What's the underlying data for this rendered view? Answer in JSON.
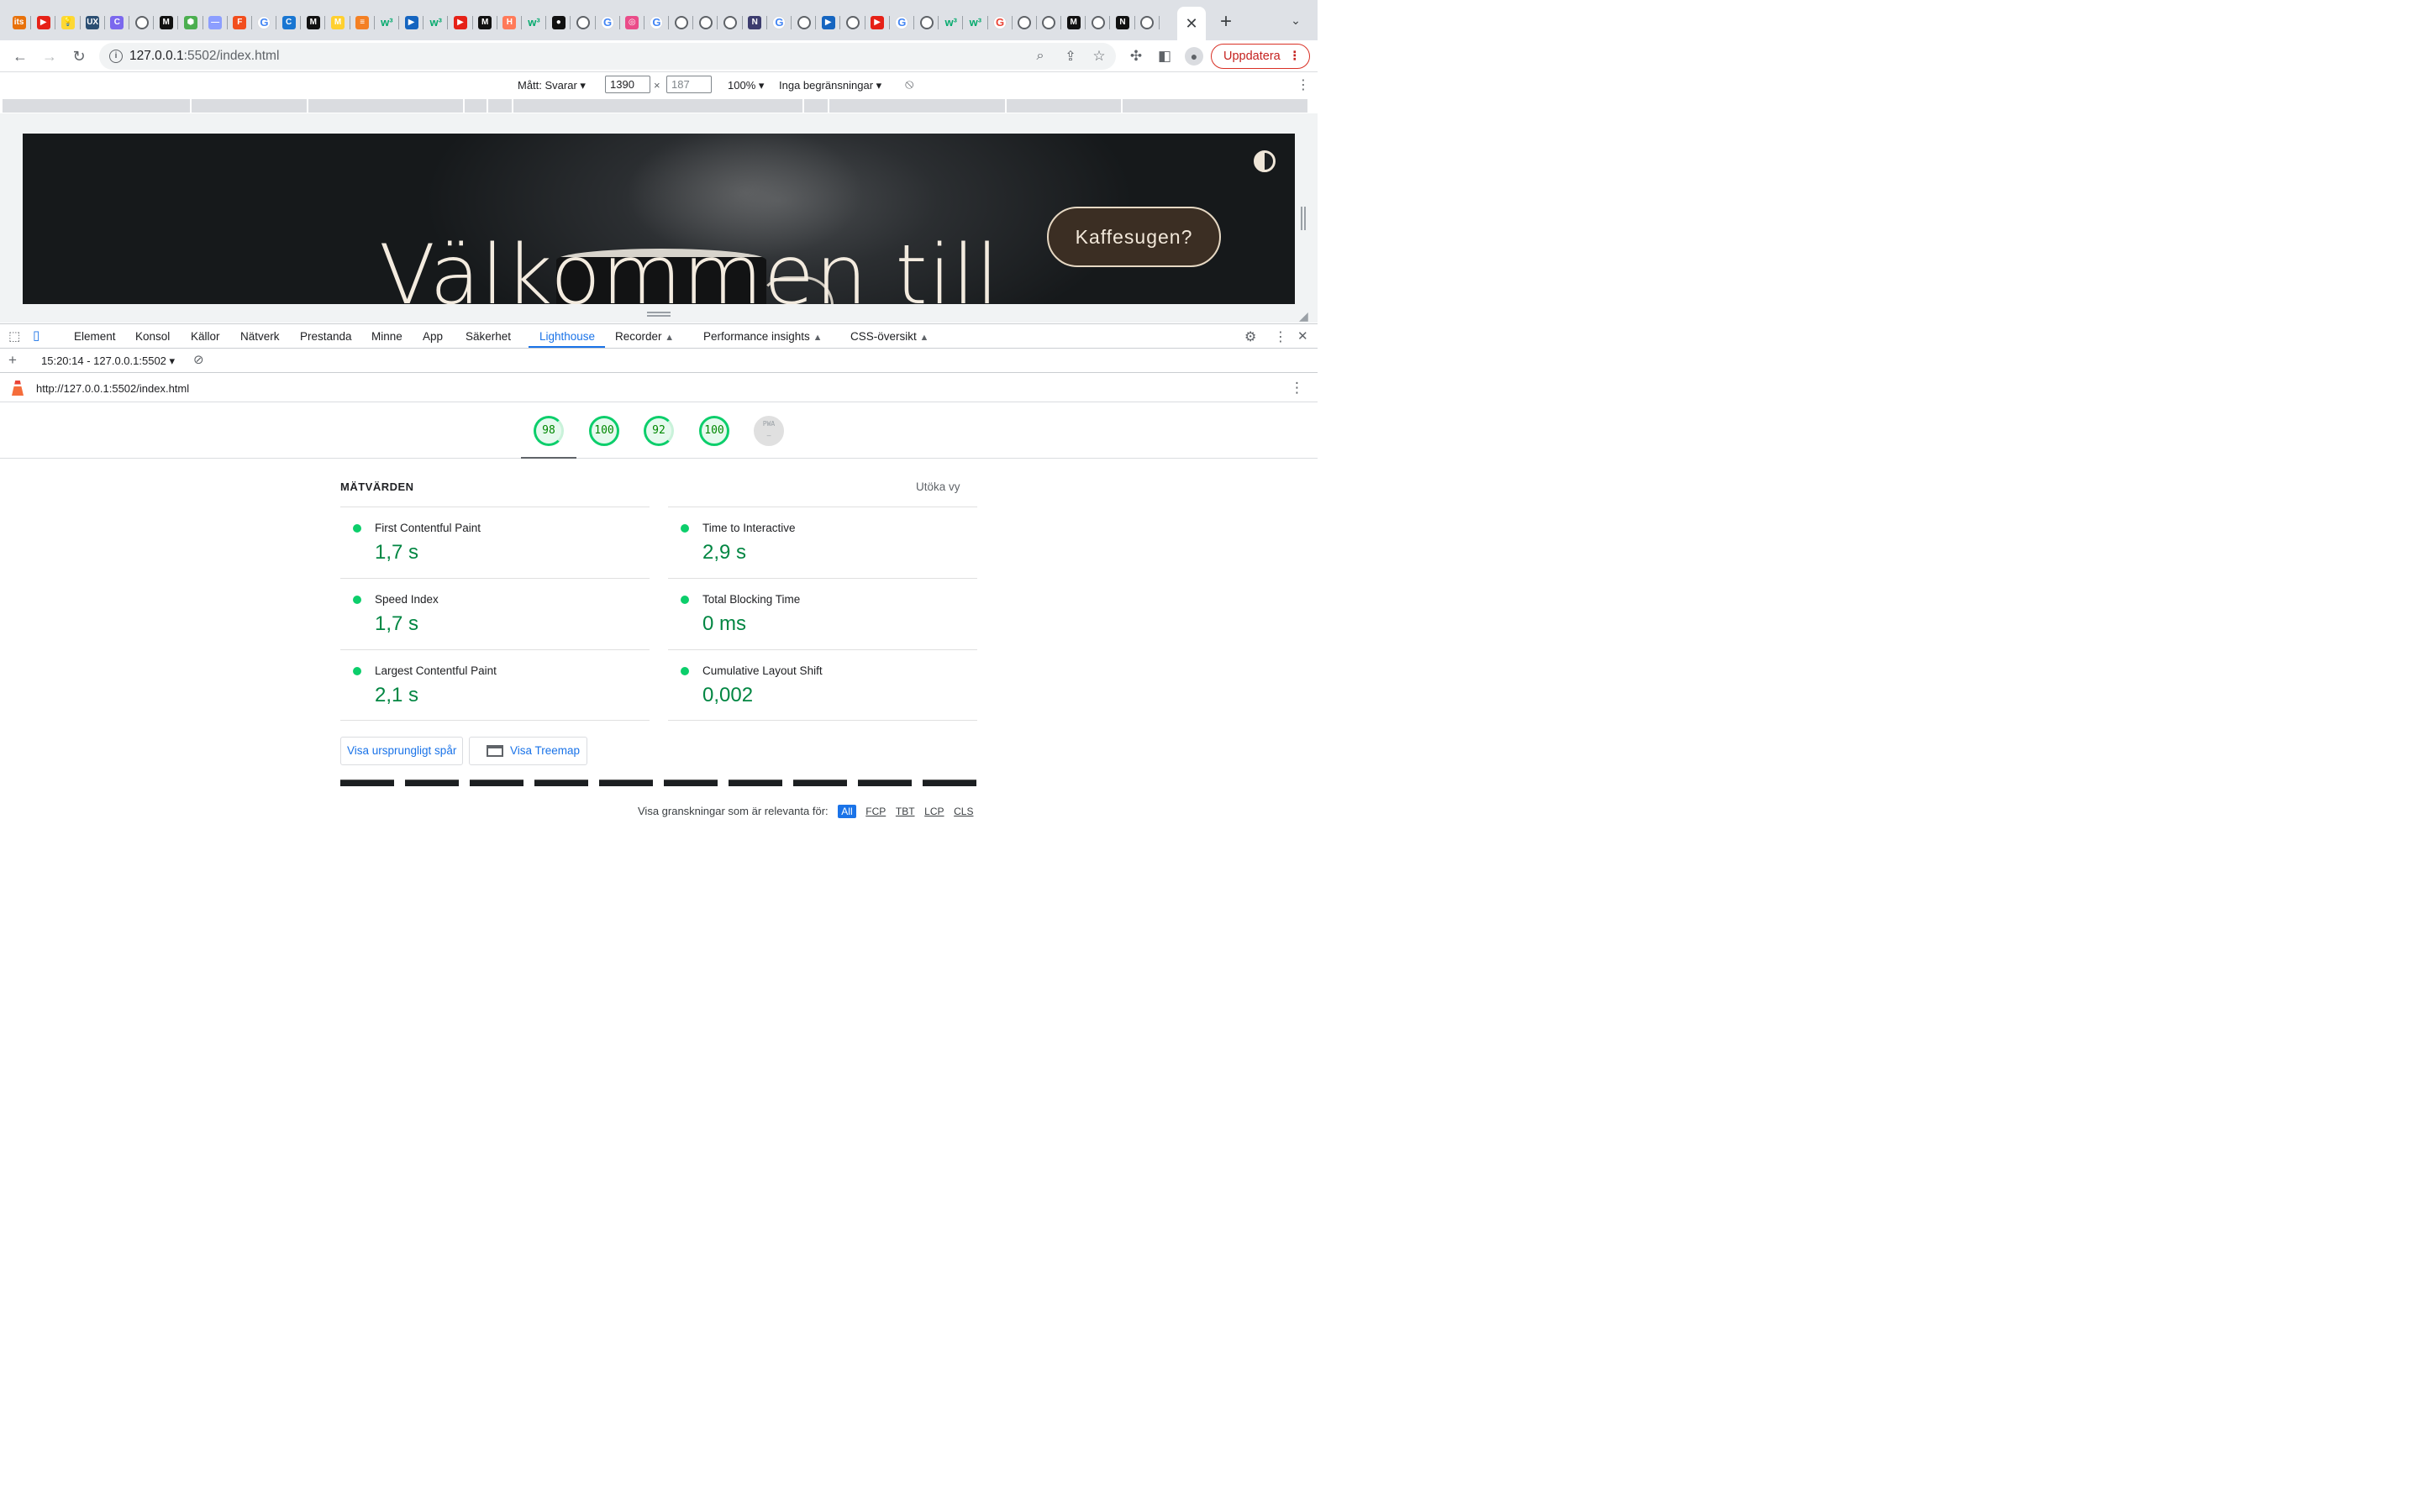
{
  "tabs": {
    "favicons": [
      {
        "icon": "its-icon",
        "label": "its",
        "color": "#e8710a"
      },
      {
        "icon": "youtube-icon",
        "label": "▶",
        "color": "#e62117"
      },
      {
        "icon": "bulb-icon",
        "label": "💡",
        "color": "#fdd835"
      },
      {
        "icon": "uxd-icon",
        "label": "UX",
        "color": "#2b4e72"
      },
      {
        "icon": "clickup-icon",
        "label": "C",
        "color": "#7b68ee"
      },
      {
        "icon": "globe-icon",
        "label": "",
        "color": ""
      },
      {
        "icon": "medium-icon",
        "label": "M",
        "color": "#111111"
      },
      {
        "icon": "node-icon",
        "label": "⬢",
        "color": "#4caf50"
      },
      {
        "icon": "line-icon",
        "label": "—",
        "color": "#8c9eff"
      },
      {
        "icon": "figma-icon",
        "label": "F",
        "color": "#f24e1e"
      },
      {
        "icon": "google-icon",
        "label": "G",
        "color": "#4285f4"
      },
      {
        "icon": "cloud-icon",
        "label": "C",
        "color": "#1976d2"
      },
      {
        "icon": "medium-icon",
        "label": "M",
        "color": "#111111"
      },
      {
        "icon": "miro-icon",
        "label": "M",
        "color": "#ffd02f"
      },
      {
        "icon": "stack-icon",
        "label": "≡",
        "color": "#f48024"
      },
      {
        "icon": "w3-icon",
        "label": "w³",
        "color": "#04aa6d"
      },
      {
        "icon": "video-icon",
        "label": "▶",
        "color": "#1565c0"
      },
      {
        "icon": "w3-icon",
        "label": "w³",
        "color": "#04aa6d"
      },
      {
        "icon": "youtube-icon",
        "label": "▶",
        "color": "#e62117"
      },
      {
        "icon": "medium-icon",
        "label": "M",
        "color": "#111111"
      },
      {
        "icon": "hubspot-icon",
        "label": "H",
        "color": "#ff7a59"
      },
      {
        "icon": "w3-icon",
        "label": "w³",
        "color": "#04aa6d"
      },
      {
        "icon": "github-icon",
        "label": "●",
        "color": "#111111"
      },
      {
        "icon": "globe-icon",
        "label": "",
        "color": ""
      },
      {
        "icon": "google-icon",
        "label": "G",
        "color": "#4285f4"
      },
      {
        "icon": "dribbble-icon",
        "label": "◎",
        "color": "#ea4c89"
      },
      {
        "icon": "google-icon",
        "label": "G",
        "color": "#4285f4"
      },
      {
        "icon": "globe-icon",
        "label": "",
        "color": ""
      },
      {
        "icon": "globe-icon",
        "label": "",
        "color": ""
      },
      {
        "icon": "globe-icon",
        "label": "",
        "color": ""
      },
      {
        "icon": "nuxt-icon",
        "label": "N",
        "color": "#3c3c6e"
      },
      {
        "icon": "google-icon",
        "label": "G",
        "color": "#4285f4"
      },
      {
        "icon": "globe-icon",
        "label": "",
        "color": ""
      },
      {
        "icon": "video-icon",
        "label": "▶",
        "color": "#1565c0"
      },
      {
        "icon": "globe-icon",
        "label": "",
        "color": ""
      },
      {
        "icon": "youtube-icon",
        "label": "▶",
        "color": "#e62117"
      },
      {
        "icon": "google-icon",
        "label": "G",
        "color": "#4285f4"
      },
      {
        "icon": "globe-icon",
        "label": "",
        "color": ""
      },
      {
        "icon": "w3-icon",
        "label": "w³",
        "color": "#04aa6d"
      },
      {
        "icon": "w3-icon",
        "label": "w³",
        "color": "#04aa6d"
      },
      {
        "icon": "chrome-icon",
        "label": "G",
        "color": "#ea4335"
      },
      {
        "icon": "globe-icon",
        "label": "",
        "color": ""
      },
      {
        "icon": "globe-icon",
        "label": "",
        "color": ""
      },
      {
        "icon": "medium-icon",
        "label": "M",
        "color": "#111111"
      },
      {
        "icon": "globe-icon",
        "label": "",
        "color": ""
      },
      {
        "icon": "notion-icon",
        "label": "N",
        "color": "#111111"
      },
      {
        "icon": "globe-icon",
        "label": "",
        "color": ""
      }
    ],
    "active_close": "✕",
    "new_tab": "+",
    "tab_search": "⌄"
  },
  "toolbar": {
    "url_host": "127.0.0.1",
    "url_rest": ":5502/index.html",
    "update_label": "Uppdatera",
    "update_menu": "⋮"
  },
  "device_toolbar": {
    "dimensions_label": "Mått: Svarar",
    "width": "1390",
    "height": "187",
    "times": "×",
    "zoom": "100%",
    "throttling": "Inga begränsningar",
    "more": "⋮"
  },
  "hero": {
    "title": "Välkommen till",
    "cta": "Kaffesugen?"
  },
  "devtools": {
    "tabs": [
      "Element",
      "Konsol",
      "Källor",
      "Nätverk",
      "Prestanda",
      "Minne",
      "App",
      "Säkerhet",
      "Lighthouse",
      "Recorder",
      "Performance insights",
      "CSS-översikt"
    ],
    "active_tab": "Lighthouse",
    "report_selector": "15:20:14 - 127.0.0.1:5502",
    "report_url": "http://127.0.0.1:5502/index.html"
  },
  "lighthouse": {
    "scores": [
      "98",
      "100",
      "92",
      "100",
      "PWA"
    ],
    "metrics_heading": "MÄTVÄRDEN",
    "expand_label": "Utöka vy",
    "metrics": [
      {
        "label": "First Contentful Paint",
        "value": "1,7 s"
      },
      {
        "label": "Speed Index",
        "value": "1,7 s"
      },
      {
        "label": "Largest Contentful Paint",
        "value": "2,1 s"
      },
      {
        "label": "Time to Interactive",
        "value": "2,9 s"
      },
      {
        "label": "Total Blocking Time",
        "value": "0 ms"
      },
      {
        "label": "Cumulative Layout Shift",
        "value": "0,002"
      }
    ],
    "view_trace": "Visa ursprungligt spår",
    "view_treemap": "Visa Treemap",
    "filter_label": "Visa granskningar som är relevanta för:",
    "filters": [
      "All",
      "FCP",
      "TBT",
      "LCP",
      "CLS"
    ],
    "accent_green": "#0cce6b"
  }
}
